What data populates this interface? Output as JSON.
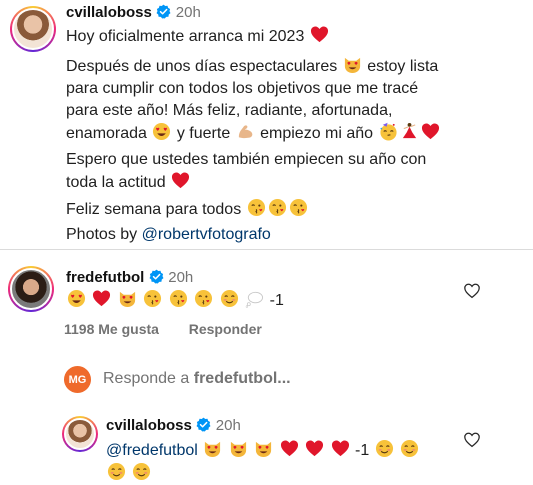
{
  "post": {
    "username": "cvillaloboss",
    "time": "20h",
    "lines": {
      "l1": "Hoy oficialmente arranca mi 2023",
      "l2a": "Después de unos días espectaculares",
      "l2b": "estoy lista",
      "l3": "para cumplir con todos los objetivos que me tracé",
      "l4": "para este año! Más feliz, radiante, afortunada,",
      "l5a": "enamorada",
      "l5b": "y fuerte",
      "l5c": "empiezo mi año",
      "l6": "Espero que ustedes también empiecen su año con",
      "l7": "toda la actitud",
      "l8": "Feliz semana para todos",
      "l9a": "Photos by ",
      "l9b": "@robertvfotografo"
    }
  },
  "comment": {
    "username": "fredefutbol",
    "time": "20h",
    "suffix": "-1",
    "likes": "1198 Me gusta",
    "reply_label": "Responder"
  },
  "reply_box": {
    "avatar_text": "MG",
    "prefix": "Responde a ",
    "target": "fredefutbol..."
  },
  "reply": {
    "username": "cvillaloboss",
    "time": "20h",
    "mention": "@fredefutbol",
    "suffix": "-1"
  },
  "colors": {
    "link": "#00376b",
    "verified": "#0095f6",
    "heart": "#e0162b",
    "muted": "#737373"
  },
  "icons": [
    "verified-badge-icon",
    "heart-outline-icon",
    "red-heart-emoji",
    "heart-eyes-cat-emoji",
    "kiss-face-emoji",
    "smiling-face-emoji",
    "flexed-biceps-emoji",
    "party-face-emoji",
    "dancer-emoji",
    "thought-bubble-emoji"
  ]
}
